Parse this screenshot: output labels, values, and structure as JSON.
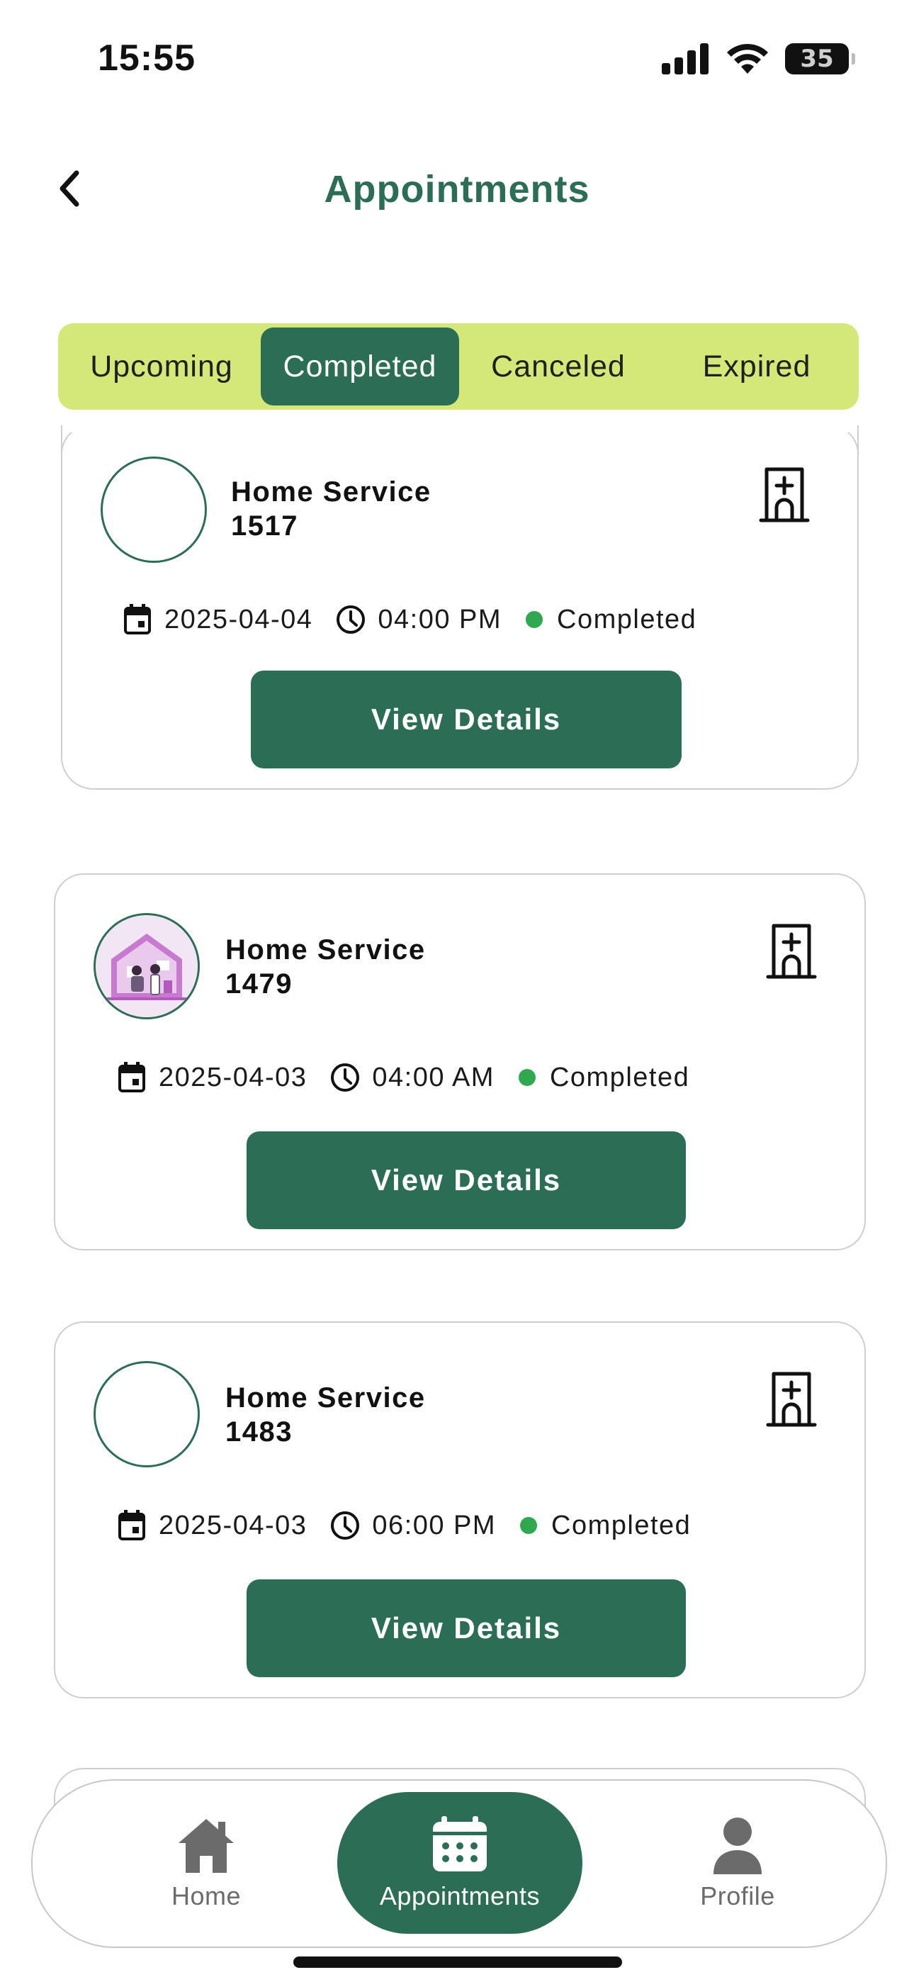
{
  "status_bar": {
    "time": "15:55",
    "battery": "35"
  },
  "header": {
    "title": "Appointments"
  },
  "tabs": [
    {
      "label": "Upcoming"
    },
    {
      "label": "Completed"
    },
    {
      "label": "Canceled"
    },
    {
      "label": "Expired"
    }
  ],
  "active_tab": "Completed",
  "appointments": [
    {
      "service": "Home Service",
      "id": "1517",
      "date": "2025-04-04",
      "time": "04:00 PM",
      "status": "Completed",
      "button": "View Details",
      "has_image": false
    },
    {
      "service": "Home Service",
      "id": "1479",
      "date": "2025-04-03",
      "time": "04:00 AM",
      "status": "Completed",
      "button": "View Details",
      "has_image": true
    },
    {
      "service": "Home Service",
      "id": "1483",
      "date": "2025-04-03",
      "time": "06:00 PM",
      "status": "Completed",
      "button": "View Details",
      "has_image": false
    }
  ],
  "colors": {
    "primary": "#2c6e55",
    "tab_bar": "#d4e87a",
    "status_dot": "#2fa84f"
  },
  "bottom_nav": {
    "items": [
      {
        "label": "Home",
        "icon": "home-icon"
      },
      {
        "label": "Appointments",
        "icon": "calendar-icon",
        "active": true
      },
      {
        "label": "Profile",
        "icon": "user-icon"
      }
    ]
  }
}
